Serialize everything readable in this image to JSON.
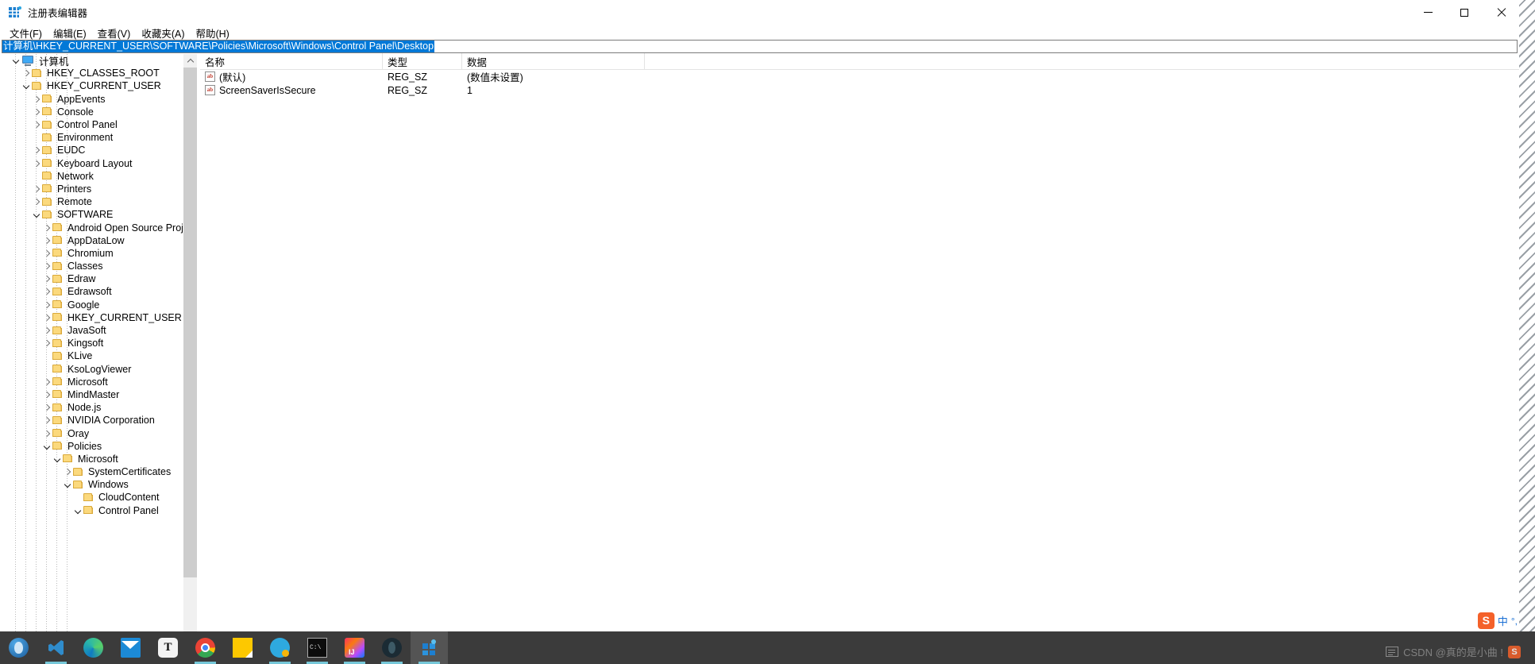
{
  "window": {
    "title": "注册表编辑器",
    "icon": "registry-editor-icon",
    "controls": {
      "minimize": "—",
      "maximize": "□",
      "close": "✕"
    }
  },
  "menubar": {
    "items": [
      {
        "label": "文件(F)",
        "name": "menu-file"
      },
      {
        "label": "编辑(E)",
        "name": "menu-edit"
      },
      {
        "label": "查看(V)",
        "name": "menu-view"
      },
      {
        "label": "收藏夹(A)",
        "name": "menu-favorites"
      },
      {
        "label": "帮助(H)",
        "name": "menu-help"
      }
    ]
  },
  "address": {
    "value": "计算机\\HKEY_CURRENT_USER\\SOFTWARE\\Policies\\Microsoft\\Windows\\Control Panel\\Desktop",
    "selected": true
  },
  "tree": {
    "items": [
      {
        "label": "计算机",
        "depth": 0,
        "toggle": "expanded",
        "icon": "computer-icon"
      },
      {
        "label": "HKEY_CLASSES_ROOT",
        "depth": 1,
        "toggle": "collapsed",
        "icon": "folder-icon"
      },
      {
        "label": "HKEY_CURRENT_USER",
        "depth": 1,
        "toggle": "expanded",
        "icon": "folder-icon"
      },
      {
        "label": "AppEvents",
        "depth": 2,
        "toggle": "collapsed",
        "icon": "folder-icon"
      },
      {
        "label": "Console",
        "depth": 2,
        "toggle": "collapsed",
        "icon": "folder-icon"
      },
      {
        "label": "Control Panel",
        "depth": 2,
        "toggle": "collapsed",
        "icon": "folder-icon"
      },
      {
        "label": "Environment",
        "depth": 2,
        "toggle": "none",
        "icon": "folder-icon"
      },
      {
        "label": "EUDC",
        "depth": 2,
        "toggle": "collapsed",
        "icon": "folder-icon"
      },
      {
        "label": "Keyboard Layout",
        "depth": 2,
        "toggle": "collapsed",
        "icon": "folder-icon"
      },
      {
        "label": "Network",
        "depth": 2,
        "toggle": "none",
        "icon": "folder-icon"
      },
      {
        "label": "Printers",
        "depth": 2,
        "toggle": "collapsed",
        "icon": "folder-icon"
      },
      {
        "label": "Remote",
        "depth": 2,
        "toggle": "collapsed",
        "icon": "folder-icon"
      },
      {
        "label": "SOFTWARE",
        "depth": 2,
        "toggle": "expanded",
        "icon": "folder-icon"
      },
      {
        "label": "Android Open Source Project",
        "depth": 3,
        "toggle": "collapsed",
        "icon": "folder-icon"
      },
      {
        "label": "AppDataLow",
        "depth": 3,
        "toggle": "collapsed",
        "icon": "folder-icon"
      },
      {
        "label": "Chromium",
        "depth": 3,
        "toggle": "collapsed",
        "icon": "folder-icon"
      },
      {
        "label": "Classes",
        "depth": 3,
        "toggle": "collapsed",
        "icon": "folder-icon"
      },
      {
        "label": "Edraw",
        "depth": 3,
        "toggle": "collapsed",
        "icon": "folder-icon"
      },
      {
        "label": "Edrawsoft",
        "depth": 3,
        "toggle": "collapsed",
        "icon": "folder-icon"
      },
      {
        "label": "Google",
        "depth": 3,
        "toggle": "collapsed",
        "icon": "folder-icon"
      },
      {
        "label": "HKEY_CURRENT_USER",
        "depth": 3,
        "toggle": "collapsed",
        "icon": "folder-icon"
      },
      {
        "label": "JavaSoft",
        "depth": 3,
        "toggle": "collapsed",
        "icon": "folder-icon"
      },
      {
        "label": "Kingsoft",
        "depth": 3,
        "toggle": "collapsed",
        "icon": "folder-icon"
      },
      {
        "label": "KLive",
        "depth": 3,
        "toggle": "none",
        "icon": "folder-icon"
      },
      {
        "label": "KsoLogViewer",
        "depth": 3,
        "toggle": "none",
        "icon": "folder-icon"
      },
      {
        "label": "Microsoft",
        "depth": 3,
        "toggle": "collapsed",
        "icon": "folder-icon"
      },
      {
        "label": "MindMaster",
        "depth": 3,
        "toggle": "collapsed",
        "icon": "folder-icon"
      },
      {
        "label": "Node.js",
        "depth": 3,
        "toggle": "collapsed",
        "icon": "folder-icon"
      },
      {
        "label": "NVIDIA Corporation",
        "depth": 3,
        "toggle": "collapsed",
        "icon": "folder-icon"
      },
      {
        "label": "Oray",
        "depth": 3,
        "toggle": "collapsed",
        "icon": "folder-icon"
      },
      {
        "label": "Policies",
        "depth": 3,
        "toggle": "expanded",
        "icon": "folder-icon"
      },
      {
        "label": "Microsoft",
        "depth": 4,
        "toggle": "expanded",
        "icon": "folder-icon"
      },
      {
        "label": "SystemCertificates",
        "depth": 5,
        "toggle": "collapsed",
        "icon": "folder-icon"
      },
      {
        "label": "Windows",
        "depth": 5,
        "toggle": "expanded",
        "icon": "folder-icon"
      },
      {
        "label": "CloudContent",
        "depth": 6,
        "toggle": "none",
        "icon": "folder-icon"
      },
      {
        "label": "Control Panel",
        "depth": 6,
        "toggle": "expanded",
        "icon": "folder-icon"
      }
    ]
  },
  "list": {
    "columns": [
      {
        "label": "名称",
        "name": "column-name"
      },
      {
        "label": "类型",
        "name": "column-type"
      },
      {
        "label": "数据",
        "name": "column-data"
      }
    ],
    "rows": [
      {
        "icon": "reg-sz-icon",
        "name": "(默认)",
        "type": "REG_SZ",
        "data": "(数值未设置)"
      },
      {
        "icon": "reg-sz-icon",
        "name": "ScreenSaverIsSecure",
        "type": "REG_SZ",
        "data": "1"
      }
    ]
  },
  "taskbar": {
    "apps": [
      {
        "name": "taskbar-steam-icon",
        "cls": "ic-steam",
        "label": "",
        "running": false,
        "active": false
      },
      {
        "name": "taskbar-vscode-icon",
        "cls": "ic-vscode",
        "label": "",
        "running": true,
        "active": false
      },
      {
        "name": "taskbar-edge-icon",
        "cls": "ic-edge",
        "label": "",
        "running": false,
        "active": false
      },
      {
        "name": "taskbar-mail-icon",
        "cls": "ic-mail",
        "label": "",
        "running": false,
        "active": false
      },
      {
        "name": "taskbar-typora-icon",
        "cls": "ic-typora",
        "label": "T",
        "running": false,
        "active": false
      },
      {
        "name": "taskbar-chrome-icon",
        "cls": "ic-chrome",
        "label": "",
        "running": true,
        "active": false
      },
      {
        "name": "taskbar-notepad-icon",
        "cls": "ic-note",
        "label": "",
        "running": false,
        "active": false
      },
      {
        "name": "taskbar-qq-icon",
        "cls": "ic-qq",
        "label": "",
        "running": true,
        "active": false
      },
      {
        "name": "taskbar-terminal-icon",
        "cls": "ic-cmd",
        "label": "C:\\",
        "running": true,
        "active": false
      },
      {
        "name": "taskbar-intellij-icon",
        "cls": "ic-idea",
        "label": "",
        "running": true,
        "active": false
      },
      {
        "name": "taskbar-wireshark-icon",
        "cls": "ic-wireshark",
        "label": "",
        "running": true,
        "active": false
      },
      {
        "name": "taskbar-regedit-icon",
        "cls": "ic-regedit",
        "label": "",
        "running": true,
        "active": true
      }
    ]
  },
  "ime": {
    "logo": "S",
    "mode": "中",
    "punctuation": "°,"
  },
  "watermark": {
    "text": "CSDN @真的是小曲 !",
    "icon": "csdn-icon",
    "badge": "S"
  },
  "colors": {
    "accent": "#0078d7",
    "titlebar_bg": "#ffffff",
    "taskbar_bg": "#3b3b3b",
    "folder": "#fbd97d",
    "scrollbar_thumb": "#cdcdcd"
  }
}
